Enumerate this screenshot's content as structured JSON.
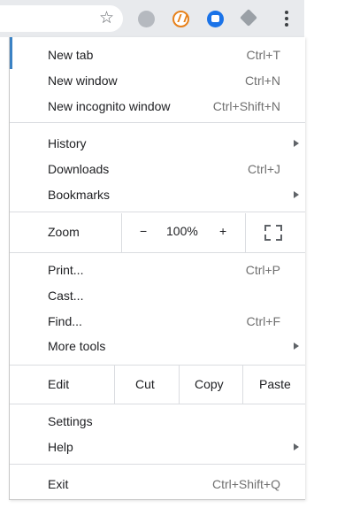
{
  "toolbar": {
    "bookmark_icon": "star-outline-icon",
    "extensions": [
      "gray-circle-extension",
      "orange-extension",
      "blue-chat-extension",
      "gray-gem-extension"
    ],
    "menu_icon": "three-dot-menu-icon"
  },
  "menu": {
    "group1": [
      {
        "label": "New tab",
        "shortcut": "Ctrl+T"
      },
      {
        "label": "New window",
        "shortcut": "Ctrl+N"
      },
      {
        "label": "New incognito window",
        "shortcut": "Ctrl+Shift+N"
      }
    ],
    "group2": [
      {
        "label": "History",
        "has_submenu": true
      },
      {
        "label": "Downloads",
        "shortcut": "Ctrl+J"
      },
      {
        "label": "Bookmarks",
        "has_submenu": true
      }
    ],
    "zoom": {
      "label": "Zoom",
      "minus": "−",
      "value": "100%",
      "plus": "+",
      "fullscreen_icon": "fullscreen-icon"
    },
    "group3": [
      {
        "label": "Print...",
        "shortcut": "Ctrl+P"
      },
      {
        "label": "Cast..."
      },
      {
        "label": "Find...",
        "shortcut": "Ctrl+F"
      },
      {
        "label": "More tools",
        "has_submenu": true
      }
    ],
    "edit": {
      "label": "Edit",
      "cut": "Cut",
      "copy": "Copy",
      "paste": "Paste"
    },
    "group4": [
      {
        "label": "Settings"
      },
      {
        "label": "Help",
        "has_submenu": true
      }
    ],
    "exit": {
      "label": "Exit",
      "shortcut": "Ctrl+Shift+Q"
    }
  },
  "colors": {
    "accent": "#3b82c4",
    "toolbar_bg": "#e8eaed",
    "shortcut_text": "#707070"
  }
}
